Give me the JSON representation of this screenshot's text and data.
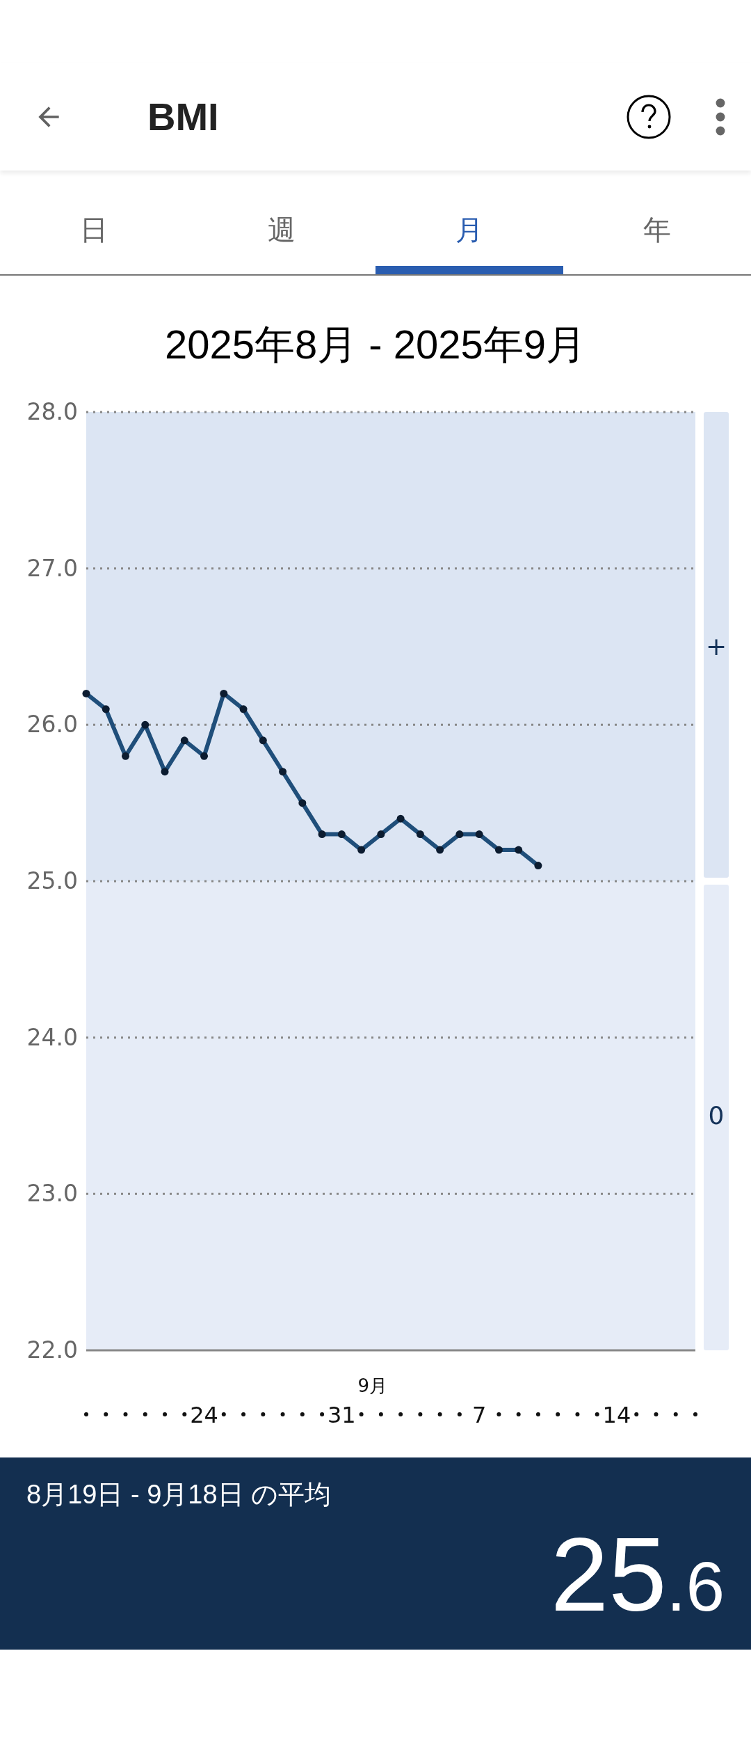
{
  "app_bar": {
    "title": "BMI"
  },
  "tabs": [
    {
      "label": "日",
      "selected": false
    },
    {
      "label": "週",
      "selected": false
    },
    {
      "label": "月",
      "selected": true
    },
    {
      "label": "年",
      "selected": false
    }
  ],
  "period": "2025年8月 - 2025年9月",
  "chart": {
    "chart_data": {
      "type": "line",
      "categories": [
        null,
        null,
        null,
        null,
        null,
        null,
        "24",
        null,
        null,
        null,
        null,
        null,
        null,
        "31",
        null,
        null,
        null,
        null,
        null,
        null,
        "7",
        null,
        null,
        null,
        null,
        null,
        null,
        "14",
        null,
        null,
        null,
        null
      ],
      "grid": true,
      "series": [
        {
          "color": "#1f4e7a",
          "marker": true,
          "values": [
            26.2,
            26.1,
            25.8,
            26.0,
            25.7,
            25.9,
            25.8,
            26.2,
            26.1,
            25.9,
            25.7,
            25.5,
            25.3,
            25.3,
            25.2,
            25.3,
            25.4,
            25.3,
            25.2,
            25.3,
            25.3,
            25.2,
            25.2,
            25.1,
            null,
            null,
            null,
            null,
            null,
            null,
            null,
            null
          ]
        }
      ],
      "ylim": [
        22,
        28
      ],
      "yticks": [
        {
          "value": 28,
          "label": "28.0"
        },
        {
          "value": 27,
          "label": "27.0"
        },
        {
          "value": 26,
          "label": "26.0"
        },
        {
          "value": 25,
          "label": "25.0"
        },
        {
          "value": 24,
          "label": "24.0"
        },
        {
          "value": 23,
          "label": "23.0"
        },
        {
          "value": 22,
          "label": "22.0"
        }
      ],
      "annotations": [
        "9月"
      ]
    },
    "zones": [
      {
        "label": "+",
        "color": "#dce5f3"
      },
      {
        "label": "0",
        "color": "#e6ecf7"
      }
    ]
  },
  "summary": {
    "label": "8月19日 - 9月18日 の平均",
    "value_integer": "25",
    "value_fraction": ".6"
  }
}
